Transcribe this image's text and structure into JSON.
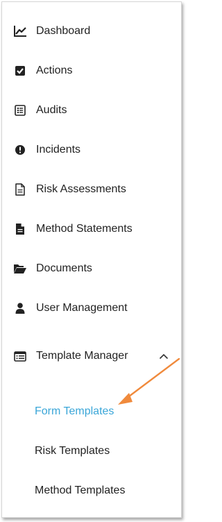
{
  "menu": {
    "items": [
      {
        "label": "Dashboard",
        "icon": "chart-line-icon"
      },
      {
        "label": "Actions",
        "icon": "checkbox-icon"
      },
      {
        "label": "Audits",
        "icon": "checklist-icon"
      },
      {
        "label": "Incidents",
        "icon": "exclamation-circle-icon"
      },
      {
        "label": "Risk Assessments",
        "icon": "document-outline-icon"
      },
      {
        "label": "Method Statements",
        "icon": "document-filled-icon"
      },
      {
        "label": "Documents",
        "icon": "folder-open-icon"
      },
      {
        "label": "User Management",
        "icon": "user-icon"
      }
    ],
    "template_manager": {
      "label": "Template Manager",
      "icon": "list-alt-icon",
      "expanded": true,
      "children": [
        {
          "label": "Form Templates",
          "active": true
        },
        {
          "label": "Risk Templates",
          "active": false
        },
        {
          "label": "Method Templates",
          "active": false
        }
      ]
    }
  },
  "colors": {
    "text": "#222222",
    "active_link": "#3aa6d8",
    "annotation_arrow": "#f08a3c"
  }
}
